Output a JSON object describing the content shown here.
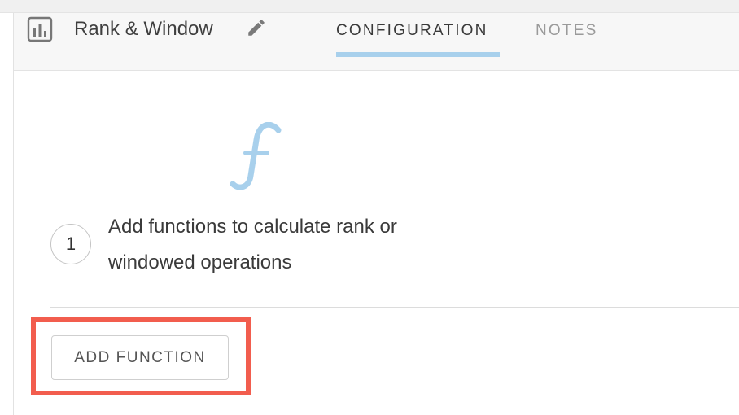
{
  "header": {
    "step_title": "Rank & Window",
    "step_icon": "bar-chart-icon",
    "edit_icon": "pencil-icon",
    "tabs": [
      {
        "label": "CONFIGURATION",
        "active": true
      },
      {
        "label": "NOTES",
        "active": false
      }
    ]
  },
  "main": {
    "function_icon": "function-f-icon",
    "step_number": "1",
    "instruction": "Add functions to calculate rank or windowed operations",
    "add_button_label": "ADD FUNCTION"
  },
  "colors": {
    "accent": "#a8d0ec",
    "highlight": "#f25d4e"
  }
}
